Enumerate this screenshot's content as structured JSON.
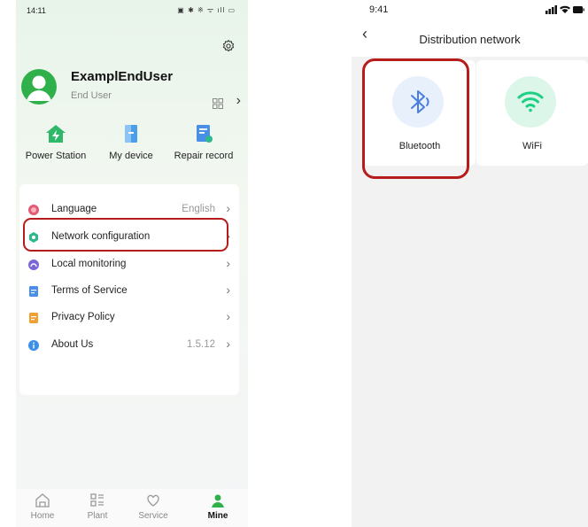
{
  "left_screen": {
    "status_time": "14:11",
    "status_icons": "▣ ✱ ※ ᯤ ıll ▭",
    "user": {
      "name": "ExamplEndUser",
      "role": "End User"
    },
    "quick_actions": [
      {
        "label": "Power Station",
        "icon": "power-station-icon"
      },
      {
        "label": "My device",
        "icon": "device-icon"
      },
      {
        "label": "Repair record",
        "icon": "repair-record-icon"
      }
    ],
    "menu": [
      {
        "label": "Language",
        "value": "English",
        "icon": "language-icon",
        "color": "#e25b73"
      },
      {
        "label": "Network configuration",
        "value": "",
        "icon": "network-config-icon",
        "color": "#2fb88e"
      },
      {
        "label": "Local monitoring",
        "value": "",
        "icon": "local-monitoring-icon",
        "color": "#7b66d6"
      },
      {
        "label": "Terms of Service",
        "value": "",
        "icon": "terms-icon",
        "color": "#4a8fe7"
      },
      {
        "label": "Privacy Policy",
        "value": "",
        "icon": "privacy-icon",
        "color": "#f0a030"
      },
      {
        "label": "About Us",
        "value": "1.5.12",
        "icon": "about-icon",
        "color": "#3c8fe8"
      }
    ],
    "bottom_nav": [
      {
        "label": "Home",
        "icon": "home-icon",
        "active": false
      },
      {
        "label": "Plant",
        "icon": "plant-icon",
        "active": false
      },
      {
        "label": "Service",
        "icon": "service-icon",
        "active": false
      },
      {
        "label": "Mine",
        "icon": "mine-icon",
        "active": true
      }
    ],
    "accent_color": "#2fb04b",
    "highlight_color": "#b71c1c"
  },
  "right_screen": {
    "status_time": "9:41",
    "title": "Distribution network",
    "methods": [
      {
        "label": "Bluetooth",
        "icon": "bluetooth-icon",
        "color": "#4a7fe0",
        "bg": "#e8f0fc"
      },
      {
        "label": "WiFi",
        "icon": "wifi-icon",
        "color": "#1ccf83",
        "bg": "#dcf7ea"
      }
    ]
  }
}
